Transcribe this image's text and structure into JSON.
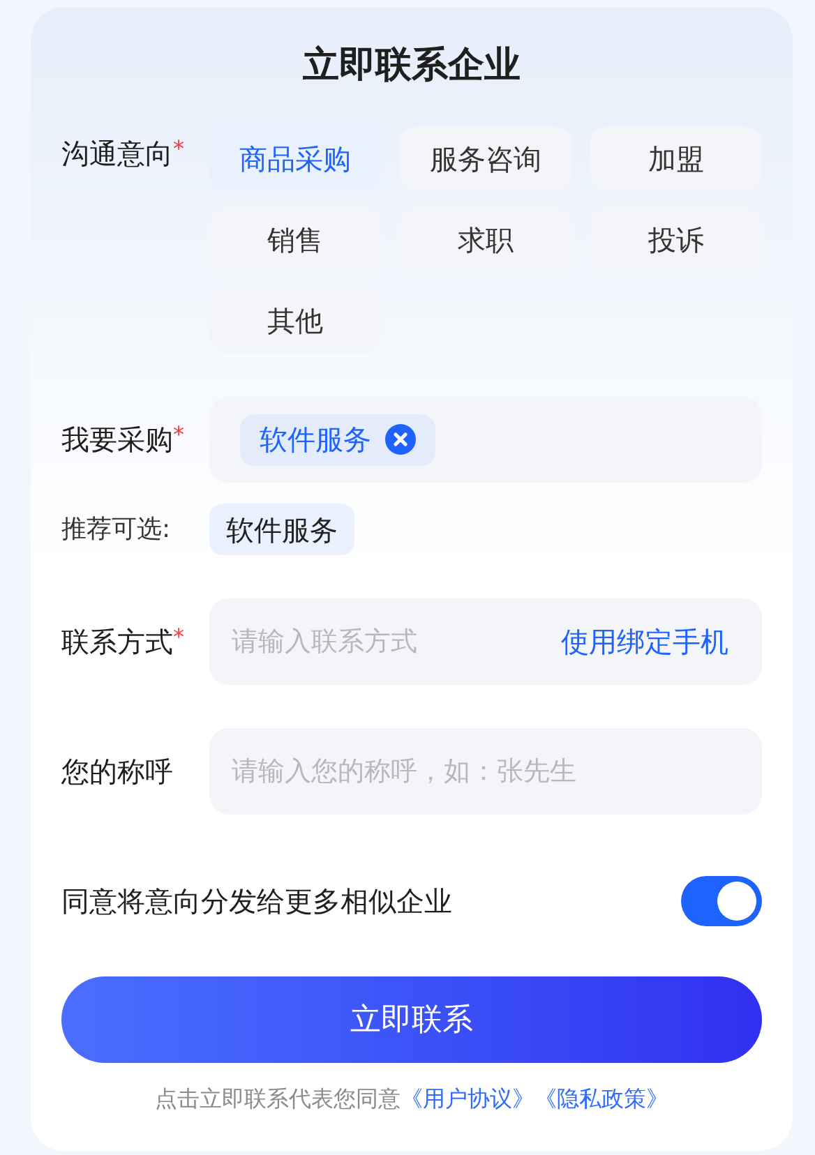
{
  "title": "立即联系企业",
  "intent": {
    "label": "沟通意向",
    "mark": "*",
    "options": [
      {
        "label": "商品采购",
        "selected": true
      },
      {
        "label": "服务咨询",
        "selected": false
      },
      {
        "label": "加盟",
        "selected": false
      },
      {
        "label": "销售",
        "selected": false
      },
      {
        "label": "求职",
        "selected": false
      },
      {
        "label": "投诉",
        "selected": false
      },
      {
        "label": "其他",
        "selected": false
      }
    ]
  },
  "purchase": {
    "label": "我要采购",
    "mark": "*",
    "tags": [
      {
        "label": "软件服务"
      }
    ]
  },
  "recommend": {
    "label": "推荐可选:",
    "options": [
      {
        "label": "软件服务"
      }
    ]
  },
  "contact": {
    "label": "联系方式",
    "mark": "*",
    "placeholder": "请输入联系方式",
    "action": "使用绑定手机"
  },
  "name": {
    "label": "您的称呼",
    "placeholder": "请输入您的称呼，如：张先生"
  },
  "share": {
    "label": "同意将意向分发给更多相似企业",
    "on": true
  },
  "submit": "立即联系",
  "footer": {
    "text": "点击立即联系代表您同意",
    "links": [
      "《用户协议》",
      "《隐私政策》"
    ]
  }
}
